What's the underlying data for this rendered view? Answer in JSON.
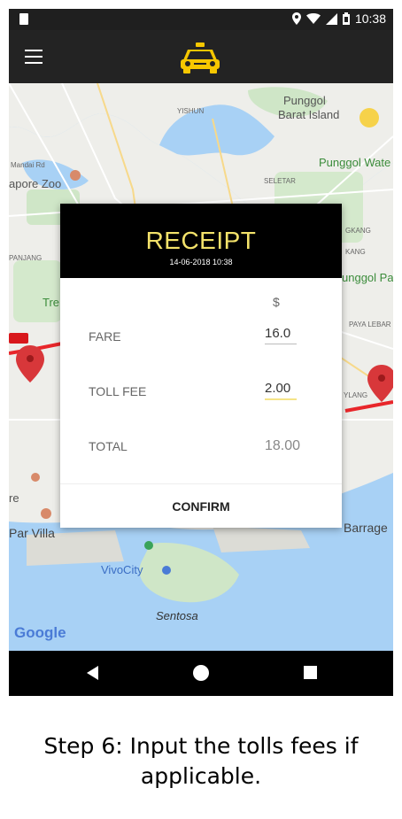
{
  "status_bar": {
    "time": "10:38"
  },
  "app_bar": {
    "menu_icon": "hamburger-menu-icon",
    "logo_icon": "taxi-icon"
  },
  "map": {
    "labels": {
      "yishun": "YISHUN",
      "punggol": "Punggol",
      "barat_island": "Barat Island",
      "singapore_zoo": "apore Zoo",
      "seletar": "SELETAR",
      "punggol_waterway": "Punggol Wate",
      "panjang": "PANJANG",
      "tre": "Tre",
      "punggol_park": "unggol Pa",
      "paya_lebar": "PAYA LEBAR",
      "ylang": "YLANG",
      "re": "re",
      "par_villa": "Par Villa",
      "barrage": "Barrage",
      "vivocity": "VivoCity",
      "sentosa": "Sentosa",
      "google": "Google",
      "mandai": "Mandai Rd",
      "kangkar": "GKANG",
      "kang": "KANG"
    }
  },
  "receipt": {
    "title": "RECEIPT",
    "datetime": "14-06-2018 10:38",
    "currency": "$",
    "fare_label": "FARE",
    "fare_value": "16.0",
    "toll_label": "TOLL FEE",
    "toll_value": "2.00",
    "total_label": "TOTAL",
    "total_value": "18.00",
    "confirm_label": "CONFIRM"
  },
  "caption": {
    "line1": "Step 6: Input the tolls fees if",
    "line2": "applicable."
  },
  "colors": {
    "accent_yellow": "#f3e26a",
    "route_red": "#e8262a",
    "map_water": "#a8d1f5",
    "map_land": "#eeeeea"
  }
}
